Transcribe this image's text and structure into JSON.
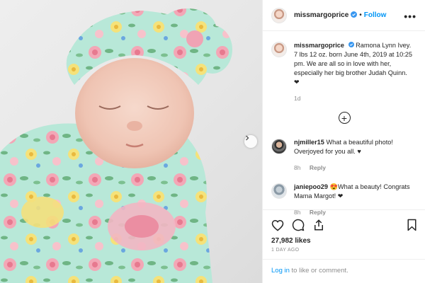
{
  "post": {
    "username": "missmargoprice",
    "follow_label": "Follow",
    "separator": "•",
    "more_label": "•••",
    "caption": "Ramona Lynn Ivey. 7 lbs 12 oz. born June 4th, 2019 at 10:25 pm. We are all so in love with her, especially her big brother Judah Quinn. ❤",
    "caption_time": "1d",
    "load_more_label": "+"
  },
  "comments": [
    {
      "username": "njmiller15",
      "text": "What a beautiful photo! Overjoyed for you all. ♥",
      "time": "8h",
      "reply_label": "Reply"
    },
    {
      "username": "janiepoo29",
      "text": "😍What a beauty! Congrats Mama Margot! ❤",
      "time": "8h",
      "reply_label": "Reply"
    }
  ],
  "actions": {
    "like_icon": "heart-outline-icon",
    "comment_icon": "comment-icon",
    "share_icon": "share-icon",
    "save_icon": "bookmark-icon",
    "likes": "27,982 likes",
    "age": "1 DAY AGO"
  },
  "login": {
    "link_label": "Log in",
    "rest_text": " to like or comment."
  },
  "colors": {
    "link_blue": "#0095f6",
    "heart_red": "#ed4956",
    "muted_gray": "#8e8e8e",
    "verified_blue": "#3897f0",
    "swaddle_mint": "#b6e6d6"
  }
}
